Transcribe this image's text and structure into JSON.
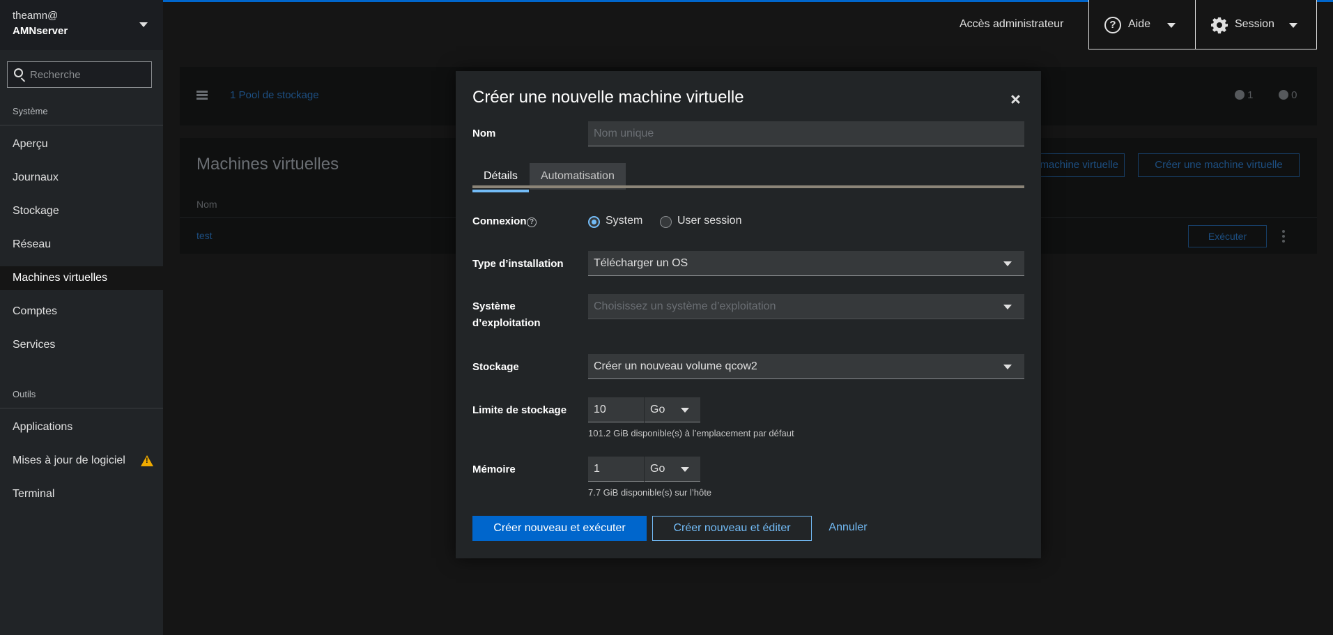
{
  "sidebar": {
    "user": "theamn@",
    "host": "AMNserver",
    "search_placeholder": "Recherche",
    "section_system": "Système",
    "system_items": [
      {
        "label": "Aperçu"
      },
      {
        "label": "Journaux"
      },
      {
        "label": "Stockage"
      },
      {
        "label": "Réseau"
      },
      {
        "label": "Machines virtuelles",
        "active": true
      },
      {
        "label": "Comptes"
      },
      {
        "label": "Services"
      }
    ],
    "section_tools": "Outils",
    "tools_items": [
      {
        "label": "Applications"
      },
      {
        "label": "Mises à jour de logiciel",
        "warning": true
      },
      {
        "label": "Terminal"
      }
    ]
  },
  "topbar": {
    "admin_access": "Accès administrateur",
    "help": "Aide",
    "session": "Session"
  },
  "background": {
    "pool_link": "1 Pool de stockage",
    "count_up": "1",
    "count_down": "0",
    "section_title": "Machines virtuelles",
    "col_name": "Nom",
    "vm_name": "test",
    "import_btn": "machine virtuelle",
    "create_btn": "Créer une machine virtuelle",
    "run_btn": "Exécuter"
  },
  "modal": {
    "title": "Créer une nouvelle machine virtuelle",
    "name_label": "Nom",
    "name_placeholder": "Nom unique",
    "name_value": "",
    "tabs": [
      "Détails",
      "Automatisation"
    ],
    "active_tab": "Détails",
    "connection_label": "Connexion",
    "connection_options": [
      {
        "label": "System",
        "checked": true
      },
      {
        "label": "User session",
        "checked": false
      }
    ],
    "install_type_label": "Type d’installation",
    "install_type_value": "Télécharger un OS",
    "os_label_1": "Système",
    "os_label_2": "d’exploitation",
    "os_placeholder": "Choisissez un système d’exploitation",
    "storage_label": "Stockage",
    "storage_value": "Créer un nouveau volume qcow2",
    "storage_limit_label": "Limite de stockage",
    "storage_limit_value": "10",
    "storage_limit_unit": "Go",
    "storage_helper": "101.2 GiB disponible(s) à l’emplacement par défaut",
    "memory_label": "Mémoire",
    "memory_value": "1",
    "memory_unit": "Go",
    "memory_helper": "7.7 GiB disponible(s) sur l’hôte",
    "btn_create_run": "Créer nouveau et exécuter",
    "btn_create_edit": "Créer nouveau et éditer",
    "btn_cancel": "Annuler"
  },
  "colors": {
    "accent": "#0066cc",
    "link": "#73bcf7",
    "warning": "#f0ab00",
    "sidebar_bg": "#212427",
    "modal_bg": "#222527"
  }
}
